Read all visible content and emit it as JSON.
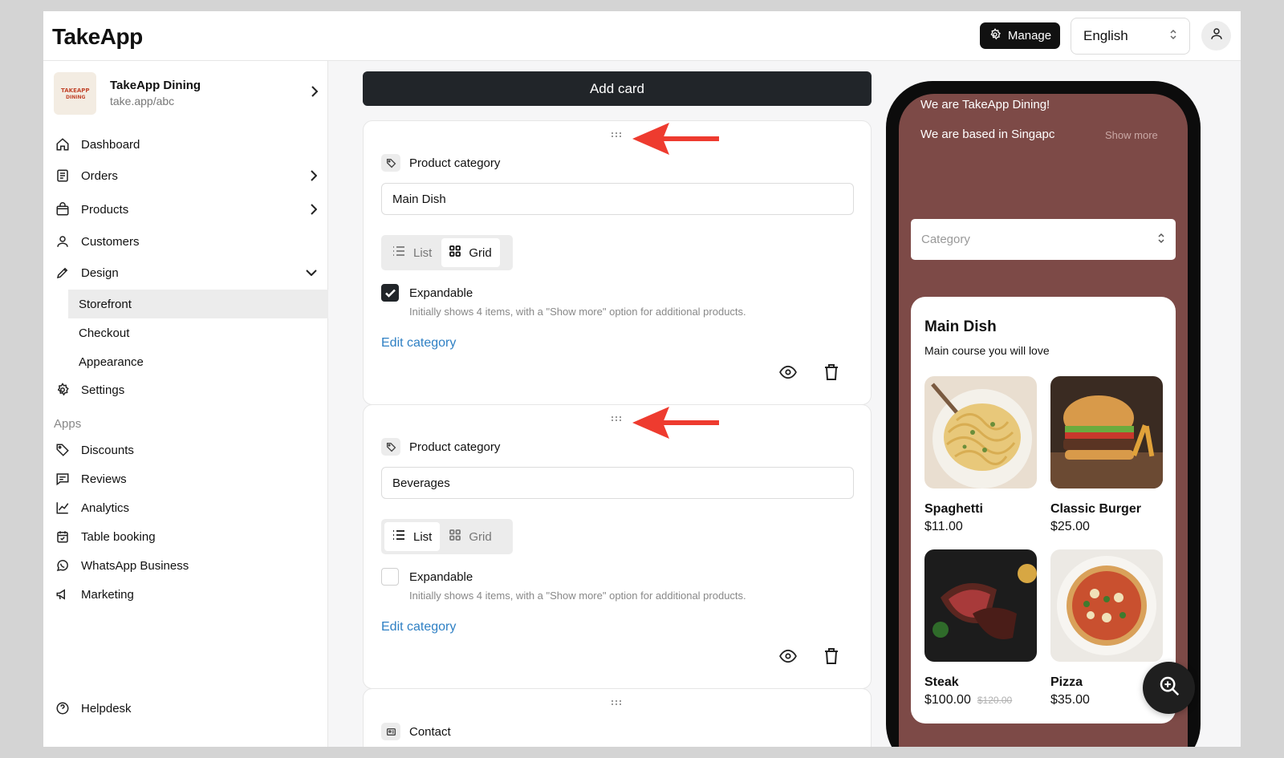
{
  "header": {
    "logo": "TakeApp",
    "manage_label": "Manage",
    "language": "English"
  },
  "sidebar": {
    "store_name": "TakeApp Dining",
    "store_url": "take.app/abc",
    "store_logo_text": "TAKEAPP DINING",
    "items": [
      {
        "label": "Dashboard"
      },
      {
        "label": "Orders"
      },
      {
        "label": "Products"
      },
      {
        "label": "Customers"
      },
      {
        "label": "Design"
      }
    ],
    "design_sub": [
      {
        "label": "Storefront"
      },
      {
        "label": "Checkout"
      },
      {
        "label": "Appearance"
      }
    ],
    "settings_label": "Settings",
    "apps_label": "Apps",
    "apps": [
      {
        "label": "Discounts"
      },
      {
        "label": "Reviews"
      },
      {
        "label": "Analytics"
      },
      {
        "label": "Table booking"
      },
      {
        "label": "WhatsApp Business"
      },
      {
        "label": "Marketing"
      }
    ],
    "helpdesk_label": "Helpdesk"
  },
  "main": {
    "add_card_label": "Add card",
    "cards": [
      {
        "type_label": "Product category",
        "category_value": "Main Dish",
        "list_label": "List",
        "grid_label": "Grid",
        "selected_view": "Grid",
        "expandable_label": "Expandable",
        "expandable_checked": true,
        "helper": "Initially shows 4 items, with a \"Show more\" option for additional products.",
        "edit_label": "Edit category"
      },
      {
        "type_label": "Product category",
        "category_value": "Beverages",
        "list_label": "List",
        "grid_label": "Grid",
        "selected_view": "List",
        "expandable_label": "Expandable",
        "expandable_checked": false,
        "helper": "Initially shows 4 items, with a \"Show more\" option for additional products.",
        "edit_label": "Edit category"
      },
      {
        "type_label": "Contact"
      }
    ]
  },
  "preview": {
    "welcome": "We are TakeApp Dining!",
    "based": "We are based in Singapc",
    "show_more": "Show more",
    "category_placeholder": "Category",
    "menu_title": "Main Dish",
    "menu_subtitle": "Main course you will love",
    "products": [
      {
        "name": "Spaghetti",
        "price": "$11.00",
        "old_price": ""
      },
      {
        "name": "Classic Burger",
        "price": "$25.00",
        "old_price": ""
      },
      {
        "name": "Steak",
        "price": "$100.00",
        "old_price": "$120.00"
      },
      {
        "name": "Pizza",
        "price": "$35.00",
        "old_price": ""
      }
    ]
  },
  "colors": {
    "accent": "#2f80c4",
    "dark": "#212529",
    "phone_bg": "#7d4a47",
    "arrow": "#ee3b2f"
  }
}
